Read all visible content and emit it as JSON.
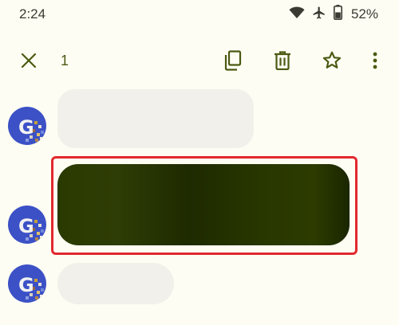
{
  "status_bar": {
    "time": "2:24",
    "battery_percent": "52%",
    "icons": [
      "wifi-icon",
      "airplane-icon",
      "battery-icon"
    ]
  },
  "action_bar": {
    "selected_count": "1",
    "icons": [
      "close-icon",
      "copy-icon",
      "delete-icon",
      "star-icon",
      "more-vert-icon"
    ]
  },
  "avatar": {
    "letter": "G"
  },
  "messages": [
    {
      "sender_initial": "G",
      "style": "received",
      "selected": false
    },
    {
      "sender_initial": "G",
      "style": "received",
      "selected": true
    },
    {
      "sender_initial": "G",
      "style": "received",
      "selected": false
    }
  ],
  "colors": {
    "background": "#fefdf3",
    "accent": "#4a5a12",
    "avatar": "#3c51c6",
    "selection_bubble": "#2a3a00",
    "highlight": "#e2282e"
  }
}
